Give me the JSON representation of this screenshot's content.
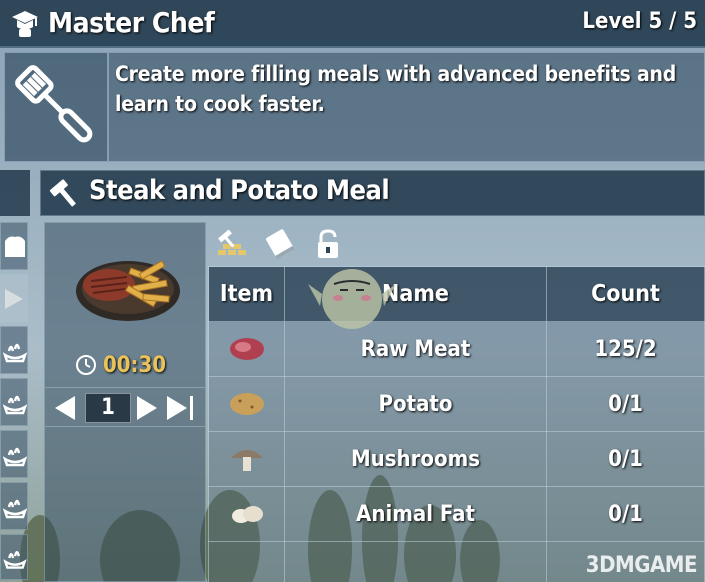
{
  "header": {
    "title": "Master Chef",
    "level": "Level 5 / 5",
    "icon": "chef-hat-icon"
  },
  "perk": {
    "description_line1": "Create more filling meals with advanced benefits and",
    "description_line2": "learn to cook faster.",
    "icon": "spatula-icon"
  },
  "recipe": {
    "title": "Steak and Potato Meal",
    "icon": "hammer-icon",
    "image": "steak-potato-meal",
    "craft_time": "00:30",
    "quantity": "1",
    "toolbar": [
      "workstation-icon",
      "book-icon",
      "unlock-icon"
    ]
  },
  "ingredients": {
    "columns": [
      "Item",
      "Name",
      "Count"
    ],
    "rows": [
      {
        "icon": "raw-meat-icon",
        "name": "Raw Meat",
        "count": "125/2"
      },
      {
        "icon": "potato-icon",
        "name": "Potato",
        "count": "0/1"
      },
      {
        "icon": "mushroom-icon",
        "name": "Mushrooms",
        "count": "0/1"
      },
      {
        "icon": "animal-fat-icon",
        "name": "Animal Fat",
        "count": "0/1"
      }
    ]
  },
  "watermark": "3DMGAME",
  "colors": {
    "timer": "#e9c35a",
    "panel": "#223a4c"
  }
}
